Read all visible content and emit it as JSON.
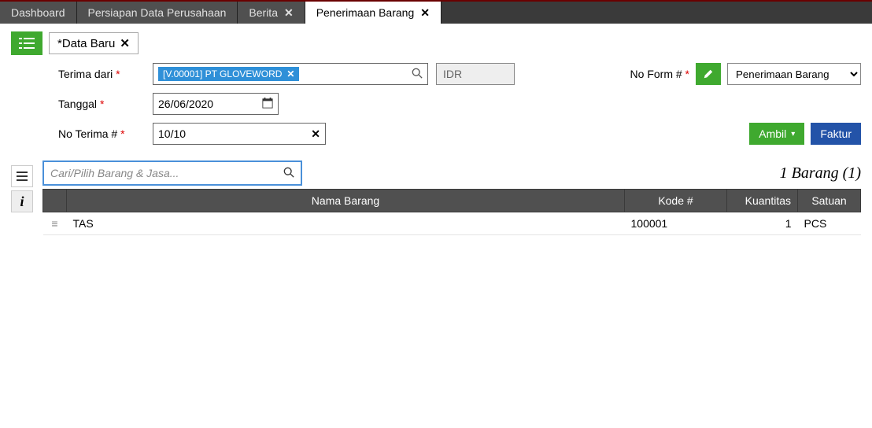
{
  "tabs": [
    {
      "label": "Dashboard",
      "closable": false,
      "active": false
    },
    {
      "label": "Persiapan Data Perusahaan",
      "closable": false,
      "active": false
    },
    {
      "label": "Berita",
      "closable": true,
      "active": false
    },
    {
      "label": "Penerimaan Barang",
      "closable": true,
      "active": true
    }
  ],
  "docTab": {
    "label": "*Data Baru"
  },
  "form": {
    "vendor_label": "Terima dari",
    "vendor_chip": "[V.00001] PT GLOVEWORD",
    "currency": "IDR",
    "noform_label": "No Form #",
    "form_type": "Penerimaan Barang",
    "date_label": "Tanggal",
    "date_value": "26/06/2020",
    "receipt_label": "No Terima #",
    "receipt_value": "10/10",
    "ambil_btn": "Ambil",
    "faktur_btn": "Faktur"
  },
  "grid": {
    "search_placeholder": "Cari/Pilih Barang & Jasa...",
    "count_text": "1 Barang (1)",
    "headers": {
      "nama": "Nama Barang",
      "kode": "Kode #",
      "qty": "Kuantitas",
      "sat": "Satuan"
    },
    "rows": [
      {
        "nama": "TAS",
        "kode": "100001",
        "qty": "1",
        "sat": "PCS"
      }
    ]
  }
}
